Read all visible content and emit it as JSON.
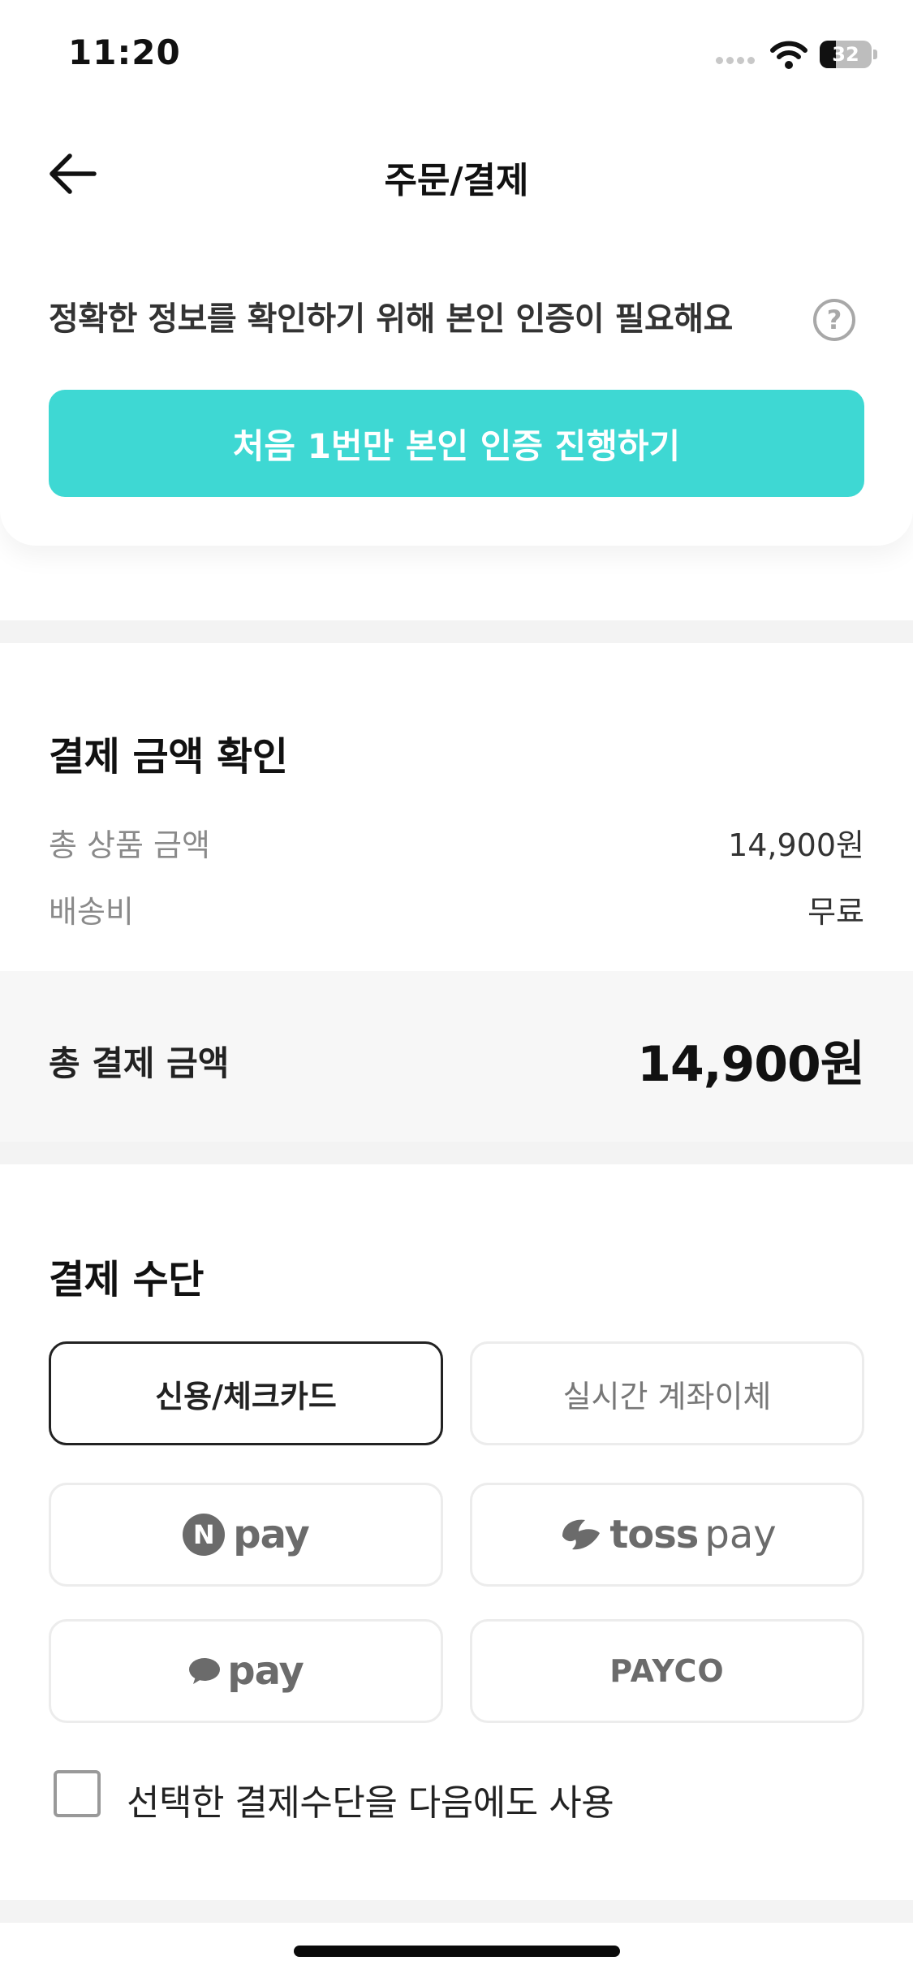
{
  "status_bar": {
    "time": "11:20",
    "battery": "32",
    "battery_level_percent": 32
  },
  "header": {
    "title": "주문/결제"
  },
  "verification": {
    "message": "정확한 정보를 확인하기 위해 본인 인증이 필요해요",
    "help_symbol": "?",
    "button_label": "처음 1번만 본인 인증 진행하기",
    "button_color": "#3ED8D3"
  },
  "payment_summary": {
    "title": "결제 금액 확인",
    "rows": [
      {
        "label": "총 상품 금액",
        "value": "14,900원"
      },
      {
        "label": "배송비",
        "value": "무료"
      }
    ],
    "total_label": "총 결제 금액",
    "total_value": "14,900원"
  },
  "payment_methods": {
    "title": "결제 수단",
    "card": "신용/체크카드",
    "bank_transfer": "실시간 계좌이체",
    "npay": {
      "badge": "N",
      "word": "pay"
    },
    "tosspay": {
      "word": "toss",
      "suffix": "pay"
    },
    "kakaopay": {
      "word": "pay"
    },
    "payco": "PAYCO",
    "selected": "신용/체크카드",
    "remember_label": "선택한 결제수단을 다음에도 사용"
  },
  "icons": [
    "back-arrow-icon",
    "help-icon",
    "wifi-icon",
    "toss-logo-icon",
    "speech-bubble-icon",
    "battery-icon"
  ]
}
